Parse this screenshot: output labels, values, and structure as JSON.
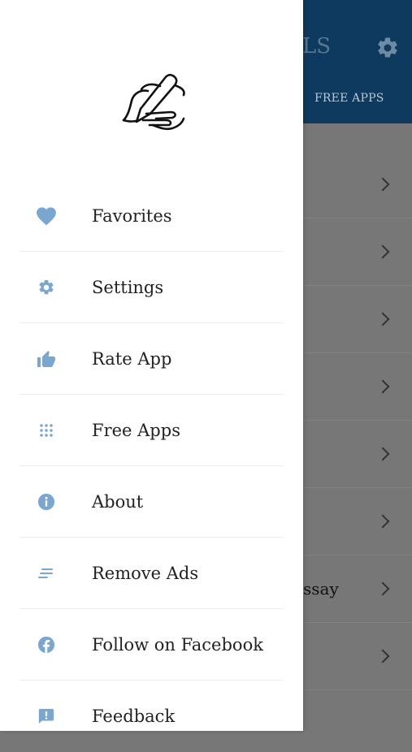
{
  "status_bar": {
    "battery_icon": "battery-full-icon"
  },
  "background_app": {
    "title_fragment": "LS",
    "tab_label": "FREE APPS",
    "settings_icon": "gear-icon",
    "rows": [
      {
        "text": ""
      },
      {
        "text": ""
      },
      {
        "text": ""
      },
      {
        "text": ""
      },
      {
        "text": ""
      },
      {
        "text": ""
      },
      {
        "text": "ssay"
      },
      {
        "text": ""
      }
    ]
  },
  "drawer": {
    "logo_icon": "hand-writing-icon",
    "accent_color": "#7aa7cf",
    "items": [
      {
        "label": "Favorites",
        "icon": "heart-icon"
      },
      {
        "label": "Settings",
        "icon": "gear-icon"
      },
      {
        "label": "Rate App",
        "icon": "thumbs-up-icon"
      },
      {
        "label": "Free Apps",
        "icon": "apps-grid-icon"
      },
      {
        "label": "About",
        "icon": "info-icon"
      },
      {
        "label": "Remove Ads",
        "icon": "lines-icon"
      },
      {
        "label": "Follow on Facebook",
        "icon": "facebook-icon"
      },
      {
        "label": "Feedback",
        "icon": "feedback-icon"
      }
    ]
  }
}
